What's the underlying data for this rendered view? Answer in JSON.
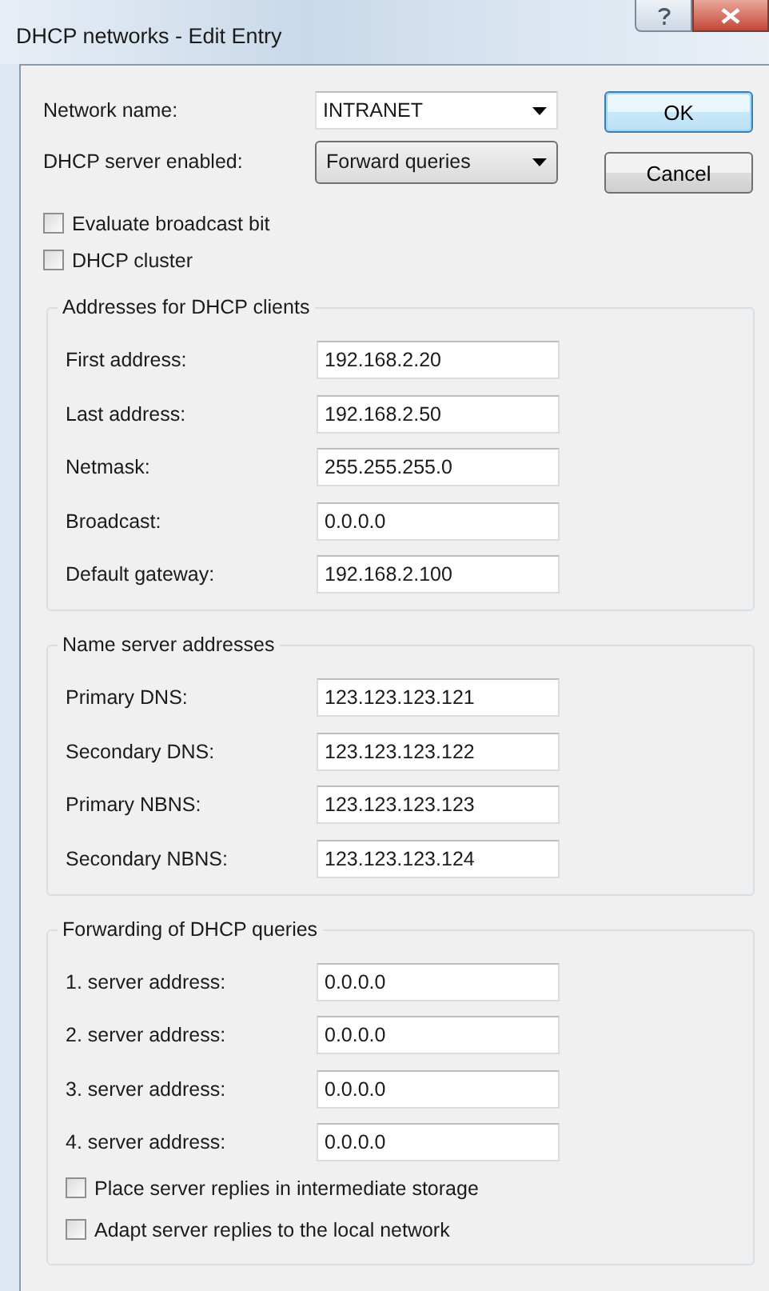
{
  "window": {
    "title": "DHCP networks - Edit Entry"
  },
  "top_fields": [
    {
      "kind": "editable-combo",
      "label": "Network name:",
      "value": "INTRANET"
    },
    {
      "kind": "combo",
      "label": "DHCP server enabled:",
      "value": "Forward queries"
    }
  ],
  "buttons": [
    {
      "label": "OK",
      "default": true
    },
    {
      "label": "Cancel",
      "default": false
    }
  ],
  "options": [
    {
      "label": "Evaluate broadcast bit",
      "checked": false
    },
    {
      "label": "DHCP cluster",
      "checked": false
    }
  ],
  "groups": [
    {
      "title": "Addresses for DHCP clients",
      "fields": [
        {
          "label": "First address:",
          "value": "192.168.2.20"
        },
        {
          "label": "Last address:",
          "value": "192.168.2.50"
        },
        {
          "label": "Netmask:",
          "value": "255.255.255.0"
        },
        {
          "label": "Broadcast:",
          "value": "0.0.0.0"
        },
        {
          "label": "Default gateway:",
          "value": "192.168.2.100"
        }
      ]
    },
    {
      "title": "Name server addresses",
      "fields": [
        {
          "label": "Primary DNS:",
          "value": "123.123.123.121"
        },
        {
          "label": "Secondary DNS:",
          "value": "123.123.123.122"
        },
        {
          "label": "Primary NBNS:",
          "value": "123.123.123.123"
        },
        {
          "label": "Secondary NBNS:",
          "value": "123.123.123.124"
        }
      ]
    },
    {
      "title": "Forwarding of DHCP queries",
      "fields": [
        {
          "label": "1. server address:",
          "value": "0.0.0.0"
        },
        {
          "label": "2. server address:",
          "value": "0.0.0.0"
        },
        {
          "label": "3. server address:",
          "value": "0.0.0.0"
        },
        {
          "label": "4. server address:",
          "value": "0.0.0.0"
        }
      ],
      "options": [
        {
          "label": "Place server replies in intermediate storage",
          "checked": false
        },
        {
          "label": "Adapt server replies to the local network",
          "checked": false
        }
      ]
    }
  ]
}
